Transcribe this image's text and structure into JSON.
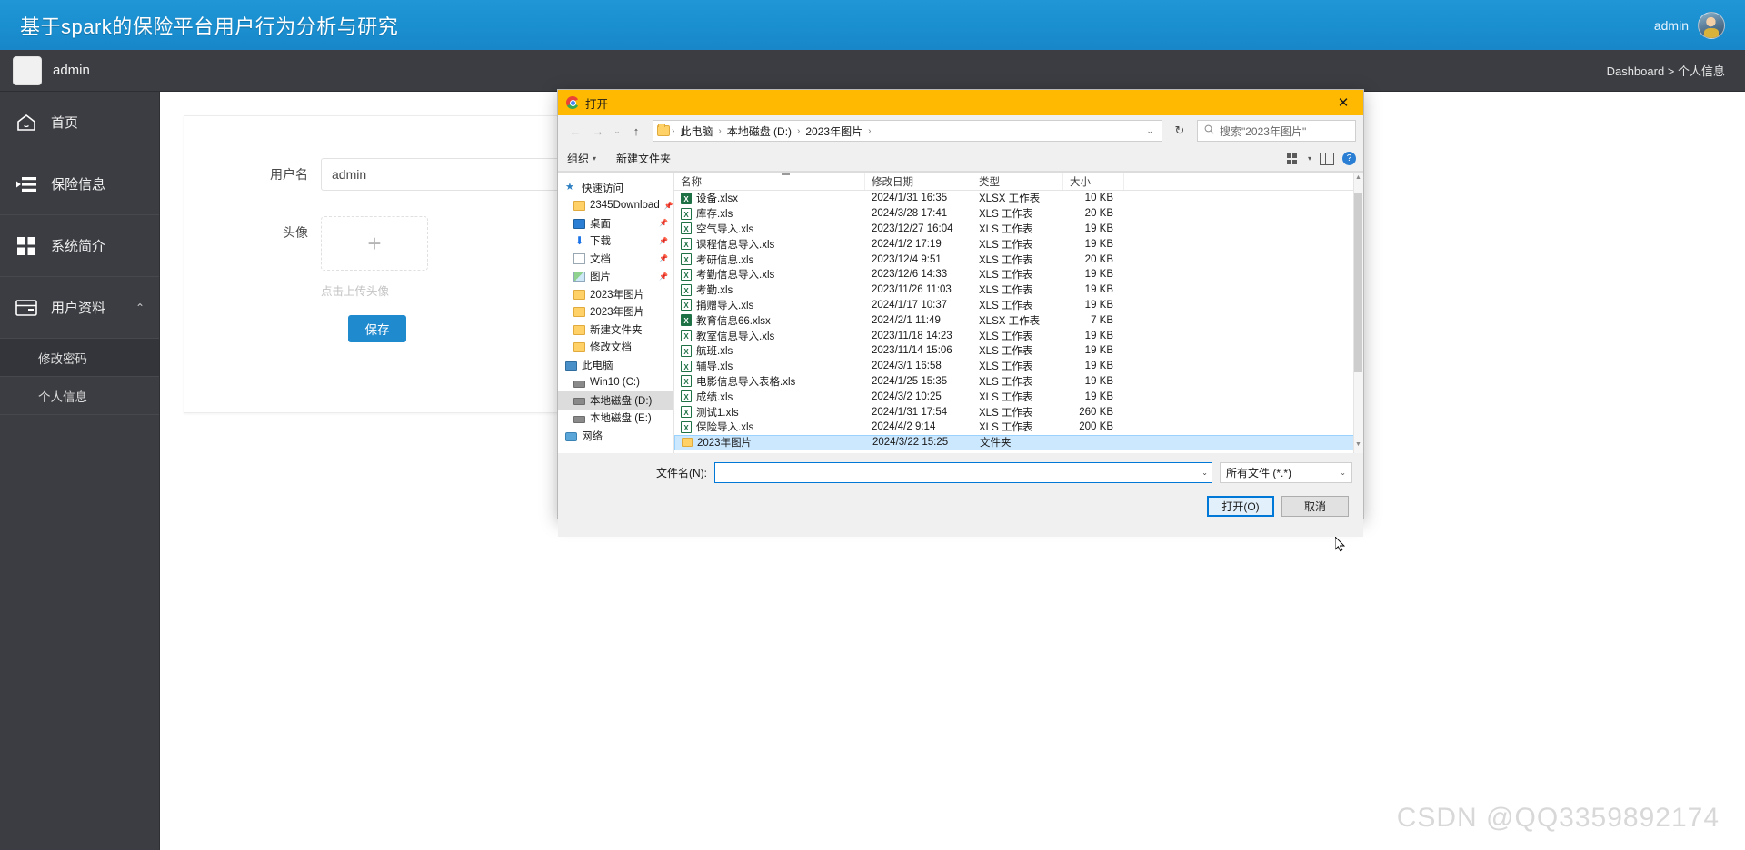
{
  "app": {
    "title": "基于spark的保险平台用户行为分析与研究",
    "topbar_user": "admin",
    "secondbar_user": "admin",
    "breadcrumb": "Dashboard > 个人信息",
    "watermark": "CSDN @QQ3359892174"
  },
  "sidebar": {
    "items": [
      {
        "label": "首页",
        "icon": "home-icon"
      },
      {
        "label": "保险信息",
        "icon": "list-icon"
      },
      {
        "label": "系统简介",
        "icon": "grid-icon"
      },
      {
        "label": "用户资料",
        "icon": "card-icon",
        "caret": "⌃"
      }
    ],
    "subitems": [
      {
        "label": "修改密码",
        "active": true
      },
      {
        "label": "个人信息",
        "active": false
      }
    ]
  },
  "form": {
    "username_label": "用户名",
    "username_value": "admin",
    "avatar_label": "头像",
    "upload_plus": "+",
    "upload_tip": "点击上传头像",
    "save_label": "保存"
  },
  "dialog": {
    "title": "打开",
    "title_icon": "chrome-icon",
    "close_icon": "✕",
    "nav": {
      "back": "←",
      "forward": "→",
      "recent": "⌄",
      "up": "↑",
      "refresh": "↻",
      "crumbs": [
        "此电脑",
        "本地磁盘 (D:)",
        "2023年图片"
      ],
      "crumb_sep": "›",
      "addr_caret": "⌄",
      "search_icon": "search-icon",
      "search_placeholder": "搜索\"2023年图片\""
    },
    "toolbar": {
      "organize": "组织",
      "organize_caret": "▾",
      "new_folder": "新建文件夹",
      "view_caret": "▾",
      "help": "?"
    },
    "tree": [
      {
        "label": "快速访问",
        "icon": "star-icon",
        "indent": false,
        "pin": false,
        "sel": false
      },
      {
        "label": "2345Download",
        "icon": "folder-icon",
        "indent": true,
        "pin": true,
        "sel": false
      },
      {
        "label": "桌面",
        "icon": "desktop-icon",
        "indent": true,
        "pin": true,
        "sel": false
      },
      {
        "label": "下载",
        "icon": "download-icon",
        "indent": true,
        "pin": true,
        "sel": false
      },
      {
        "label": "文档",
        "icon": "documents-icon",
        "indent": true,
        "pin": true,
        "sel": false
      },
      {
        "label": "图片",
        "icon": "pictures-icon",
        "indent": true,
        "pin": true,
        "sel": false
      },
      {
        "label": "2023年图片",
        "icon": "folder-icon",
        "indent": true,
        "pin": false,
        "sel": false
      },
      {
        "label": "2023年图片",
        "icon": "folder-icon",
        "indent": true,
        "pin": false,
        "sel": false
      },
      {
        "label": "新建文件夹",
        "icon": "folder-icon",
        "indent": true,
        "pin": false,
        "sel": false
      },
      {
        "label": "修改文档",
        "icon": "folder-icon",
        "indent": true,
        "pin": false,
        "sel": false
      },
      {
        "label": "此电脑",
        "icon": "pc-icon",
        "indent": false,
        "pin": false,
        "sel": false
      },
      {
        "label": "Win10 (C:)",
        "icon": "drive-icon",
        "indent": true,
        "pin": false,
        "sel": false
      },
      {
        "label": "本地磁盘 (D:)",
        "icon": "drive-icon",
        "indent": true,
        "pin": false,
        "sel": true
      },
      {
        "label": "本地磁盘 (E:)",
        "icon": "drive-icon",
        "indent": true,
        "pin": false,
        "sel": false
      },
      {
        "label": "网络",
        "icon": "network-icon",
        "indent": false,
        "pin": false,
        "sel": false
      }
    ],
    "columns": [
      "名称",
      "修改日期",
      "类型",
      "大小"
    ],
    "files": [
      {
        "name": "设备.xlsx",
        "date": "2024/1/31 16:35",
        "type": "XLSX 工作表",
        "size": "10 KB",
        "icon": "xlsx-icon",
        "sel": false
      },
      {
        "name": "库存.xls",
        "date": "2024/3/28 17:41",
        "type": "XLS 工作表",
        "size": "20 KB",
        "icon": "xls-icon",
        "sel": false
      },
      {
        "name": "空气导入.xls",
        "date": "2023/12/27 16:04",
        "type": "XLS 工作表",
        "size": "19 KB",
        "icon": "xls-icon",
        "sel": false
      },
      {
        "name": "课程信息导入.xls",
        "date": "2024/1/2 17:19",
        "type": "XLS 工作表",
        "size": "19 KB",
        "icon": "xls-icon",
        "sel": false
      },
      {
        "name": "考研信息.xls",
        "date": "2023/12/4 9:51",
        "type": "XLS 工作表",
        "size": "20 KB",
        "icon": "xls-icon",
        "sel": false
      },
      {
        "name": "考勤信息导入.xls",
        "date": "2023/12/6 14:33",
        "type": "XLS 工作表",
        "size": "19 KB",
        "icon": "xls-icon",
        "sel": false
      },
      {
        "name": "考勤.xls",
        "date": "2023/11/26 11:03",
        "type": "XLS 工作表",
        "size": "19 KB",
        "icon": "xls-icon",
        "sel": false
      },
      {
        "name": "捐赠导入.xls",
        "date": "2024/1/17 10:37",
        "type": "XLS 工作表",
        "size": "19 KB",
        "icon": "xls-icon",
        "sel": false
      },
      {
        "name": "教育信息66.xlsx",
        "date": "2024/2/1 11:49",
        "type": "XLSX 工作表",
        "size": "7 KB",
        "icon": "xlsx-icon",
        "sel": false
      },
      {
        "name": "教室信息导入.xls",
        "date": "2023/11/18 14:23",
        "type": "XLS 工作表",
        "size": "19 KB",
        "icon": "xls-icon",
        "sel": false
      },
      {
        "name": "航班.xls",
        "date": "2023/11/14 15:06",
        "type": "XLS 工作表",
        "size": "19 KB",
        "icon": "xls-icon",
        "sel": false
      },
      {
        "name": "辅导.xls",
        "date": "2024/3/1 16:58",
        "type": "XLS 工作表",
        "size": "19 KB",
        "icon": "xls-icon",
        "sel": false
      },
      {
        "name": "电影信息导入表格.xls",
        "date": "2024/1/25 15:35",
        "type": "XLS 工作表",
        "size": "19 KB",
        "icon": "xls-icon",
        "sel": false
      },
      {
        "name": "成绩.xls",
        "date": "2024/3/2 10:25",
        "type": "XLS 工作表",
        "size": "19 KB",
        "icon": "xls-icon",
        "sel": false
      },
      {
        "name": "测试1.xls",
        "date": "2024/1/31 17:54",
        "type": "XLS 工作表",
        "size": "260 KB",
        "icon": "xls-icon",
        "sel": false
      },
      {
        "name": "保险导入.xls",
        "date": "2024/4/2 9:14",
        "type": "XLS 工作表",
        "size": "200 KB",
        "icon": "xls-icon",
        "sel": false
      },
      {
        "name": "2023年图片",
        "date": "2024/3/22 15:25",
        "type": "文件夹",
        "size": "",
        "icon": "folder-icon",
        "sel": true
      }
    ],
    "footer": {
      "filename_label": "文件名(N):",
      "filename_value": "",
      "filename_caret": "⌄",
      "filter_value": "所有文件 (*.*)",
      "filter_caret": "⌄",
      "open_label": "打开(O)",
      "cancel_label": "取消"
    }
  }
}
